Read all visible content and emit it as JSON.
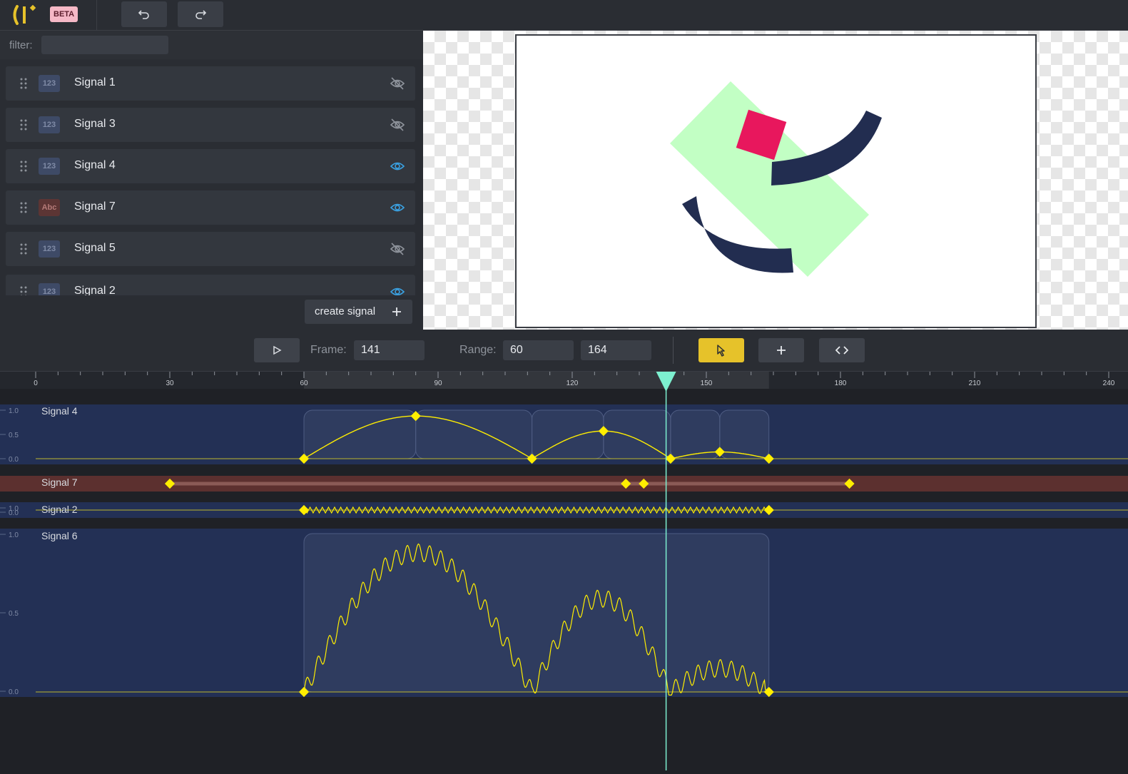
{
  "app": {
    "beta_label": "BETA",
    "undo_icon": "undo-icon",
    "redo_icon": "redo-icon"
  },
  "sidebar": {
    "filter_label": "filter:",
    "filter_value": "",
    "signals": [
      {
        "name": "Signal 1",
        "type": "123",
        "kind": "number",
        "visible": false
      },
      {
        "name": "Signal 3",
        "type": "123",
        "kind": "number",
        "visible": false
      },
      {
        "name": "Signal 4",
        "type": "123",
        "kind": "number",
        "visible": true
      },
      {
        "name": "Signal 7",
        "type": "Abc",
        "kind": "string",
        "visible": true
      },
      {
        "name": "Signal 5",
        "type": "123",
        "kind": "number",
        "visible": false
      },
      {
        "name": "Signal 2",
        "type": "123",
        "kind": "number",
        "visible": true
      }
    ],
    "create_label": "create signal"
  },
  "controls": {
    "frame_label": "Frame:",
    "frame_value": "141",
    "range_label": "Range:",
    "range_start": "60",
    "range_end": "164"
  },
  "timeline": {
    "ruler_ticks": [
      "0",
      "30",
      "60",
      "90",
      "120",
      "150",
      "180",
      "210",
      "240"
    ],
    "current_frame": 141,
    "range": [
      60,
      164
    ],
    "tracks": [
      {
        "name": "Signal 4",
        "axis_labels": [
          "1.0",
          "0.5",
          "0.0"
        ]
      },
      {
        "name": "Signal 7",
        "axis_labels": []
      },
      {
        "name": "Signal 2",
        "axis_labels": [
          "1.0",
          "0.0"
        ]
      },
      {
        "name": "Signal 6",
        "axis_labels": [
          "1.0",
          "0.5",
          "0.0"
        ]
      }
    ]
  },
  "colors": {
    "accent": "#e6c22a",
    "keyframe": "#ffee00",
    "playhead": "#7df0d0",
    "number_track": "#233055",
    "string_track": "#5c302f",
    "shape_green": "#c2ffc4",
    "shape_pink": "#e8175d",
    "shape_navy": "#222d50",
    "eye_visible": "#3aa0e0"
  }
}
